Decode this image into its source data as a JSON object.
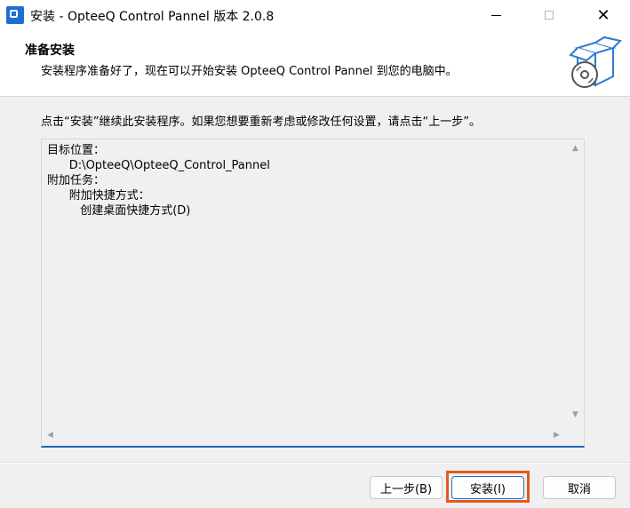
{
  "window": {
    "title": "安装 - OpteeQ Control Pannel 版本 2.0.8",
    "controls": {
      "minimize": "minimize-icon",
      "maximize": "maximize-icon",
      "close": "✕"
    }
  },
  "header": {
    "title": "准备安装",
    "subtitle": "安装程序准备好了，现在可以开始安装 OpteeQ Control Pannel 到您的电脑中。",
    "graphic_icon": "install-box-disc-icon"
  },
  "instruction": "点击“安装”继续此安装程序。如果您想要重新考虑或修改任何设置，请点击“上一步”。",
  "memo": {
    "lines": [
      "目标位置：",
      "      D:\\OpteeQ\\OpteeQ_Control_Pannel",
      "",
      "附加任务：",
      "      附加快捷方式：",
      "         创建桌面快捷方式(D)"
    ]
  },
  "buttons": {
    "back": "上一步(B)",
    "install": "安装(I)",
    "cancel": "取消"
  },
  "colors": {
    "accent": "#1f6fd0",
    "highlight": "#e35a1f"
  }
}
